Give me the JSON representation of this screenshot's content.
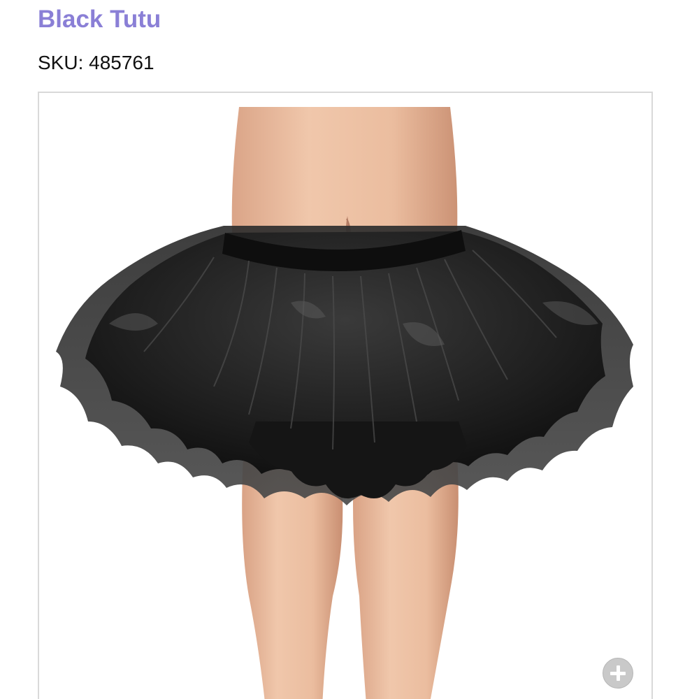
{
  "product": {
    "title": "Black Tutu",
    "sku_label": "SKU:",
    "sku_value": "485761"
  },
  "colors": {
    "title": "#8a7fd6",
    "frame_border": "#d9d9d9",
    "tutu": "#1a1a1a",
    "skin": "#e9b99a"
  },
  "gallery": {
    "zoom_icon": "plus-circle-icon"
  }
}
